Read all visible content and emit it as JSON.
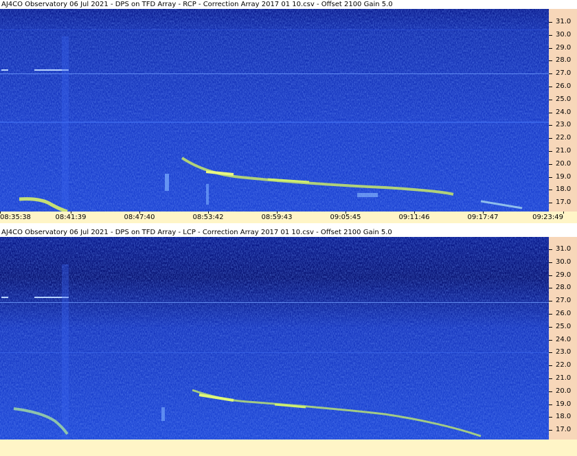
{
  "panels": [
    {
      "title": "AJ4CO Observatory 06 Jul 2021  -  DPS on TFD Array  -  RCP  -  Correction Array 2017 01 10.csv  -  Offset 2100  Gain 5.0",
      "polarization": "RCP"
    },
    {
      "title": "AJ4CO Observatory 06 Jul 2021  -  DPS on TFD Array  -  LCP  -  Correction Array 2017 01 10.csv  -  Offset 2100  Gain 5.0",
      "polarization": "LCP"
    }
  ],
  "frequency_labels": [
    "31.0",
    "30.0",
    "29.0",
    "28.0",
    "27.0",
    "26.0",
    "25.0",
    "24.0",
    "23.0",
    "22.0",
    "21.0",
    "20.0",
    "19.0",
    "18.0",
    "17.0"
  ],
  "time_labels": [
    "08:35:38",
    "08:41:39",
    "08:47:40",
    "08:53:42",
    "08:59:43",
    "09:05:45",
    "09:11:46",
    "09:17:47",
    "09:23:49"
  ],
  "colors": {
    "spectrogram_base": "#1f3fcf",
    "spectrogram_dark": "#08147a",
    "emission": "#d8f070",
    "freq_axis_bg": "#f7d7b9",
    "time_axis_bg": "#fff5c7"
  }
}
